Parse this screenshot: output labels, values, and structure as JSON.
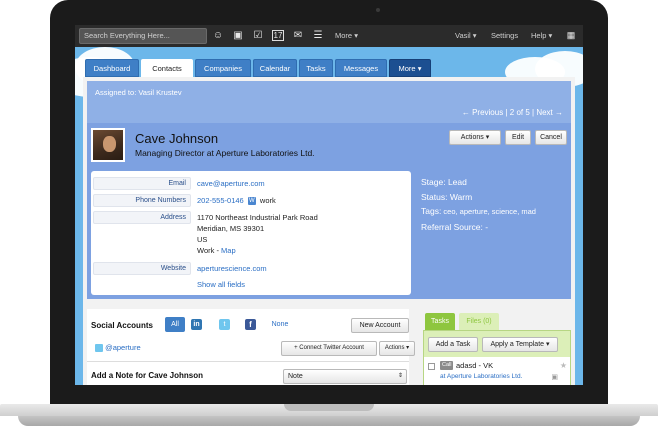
{
  "topbar": {
    "search_placeholder": "Search Everything Here...",
    "more_label": "More",
    "user_label": "Vasil",
    "settings_label": "Settings",
    "help_label": "Help"
  },
  "tabs": [
    "Dashboard",
    "Contacts",
    "Companies",
    "Calendar",
    "Tasks",
    "Messages",
    "More"
  ],
  "assigned": "Assigned to: Vasil Krustev",
  "pager": {
    "previous": "← Previous",
    "position": "2 of 5",
    "next": "Next →"
  },
  "contact": {
    "name": "Cave Johnson",
    "title": "Managing Director at Aperture Laboratories Ltd.",
    "buttons": {
      "actions": "Actions",
      "edit": "Edit",
      "cancel": "Cancel"
    },
    "fields": {
      "email_label": "Email",
      "email": "cave@aperture.com",
      "phone_label": "Phone Numbers",
      "phone": "202-555-0146",
      "phone_badge": "W",
      "phone_type": "work",
      "address_label": "Address",
      "address_line1": "1170 Northeast Industrial Park Road",
      "address_line2": "Meridian, MS 39301",
      "address_line3": "US",
      "address_type": "Work - ",
      "map_link": "Map",
      "website_label": "Website",
      "website": "aperturescience.com",
      "show_all": "Show all fields"
    },
    "stage_label": "Stage:",
    "stage": "Lead",
    "status_label": "Status:",
    "status": "Warm",
    "tags_label": "Tags:",
    "tags": "ceo, aperture, science, mad",
    "referral_label": "Referral Source:",
    "referral": "-"
  },
  "social": {
    "title": "Social Accounts",
    "all": "All",
    "none": "None",
    "new_account": "New Account",
    "twitter_handle": "@aperture",
    "connect": "Connect Twitter Account",
    "actions": "Actions"
  },
  "note": {
    "title": "Add a Note for Cave Johnson",
    "type": "Note"
  },
  "tasks": {
    "tab_tasks": "Tasks",
    "tab_files": "Files (0)",
    "add_task": "Add a Task",
    "apply_template": "Apply a Template",
    "item_badge": "Call",
    "item_title": "adasd - VK",
    "item_sub": "at Aperture Laboratories Ltd."
  },
  "colors": {
    "accent": "#3f7fc6",
    "header_bg": "#2b2b2b",
    "card_bg": "#7da1e1"
  }
}
